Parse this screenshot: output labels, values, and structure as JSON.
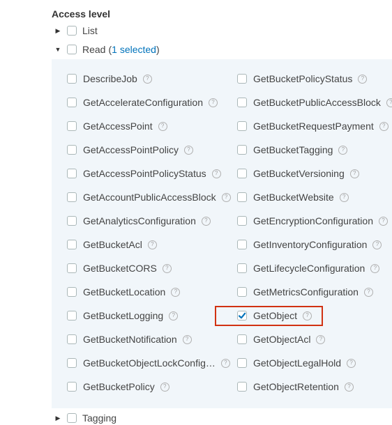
{
  "access_level": {
    "heading": "Access level",
    "groups": {
      "list": {
        "label": "List"
      },
      "read": {
        "label": "Read",
        "open_paren": "(",
        "selected_text": "1 selected",
        "close_paren": ")"
      },
      "tagging": {
        "label": "Tagging"
      }
    },
    "help_glyph": "?",
    "left_column": [
      {
        "label": "DescribeJob",
        "checked": false
      },
      {
        "label": "GetAccelerateConfiguration",
        "checked": false
      },
      {
        "label": "GetAccessPoint",
        "checked": false
      },
      {
        "label": "GetAccessPointPolicy",
        "checked": false
      },
      {
        "label": "GetAccessPointPolicyStatus",
        "checked": false
      },
      {
        "label": "GetAccountPublicAccessBlock",
        "checked": false
      },
      {
        "label": "GetAnalyticsConfiguration",
        "checked": false
      },
      {
        "label": "GetBucketAcl",
        "checked": false
      },
      {
        "label": "GetBucketCORS",
        "checked": false
      },
      {
        "label": "GetBucketLocation",
        "checked": false
      },
      {
        "label": "GetBucketLogging",
        "checked": false
      },
      {
        "label": "GetBucketNotification",
        "checked": false
      },
      {
        "label": "GetBucketObjectLockConfig…",
        "checked": false
      },
      {
        "label": "GetBucketPolicy",
        "checked": false
      }
    ],
    "right_column": [
      {
        "label": "GetBucketPolicyStatus",
        "checked": false
      },
      {
        "label": "GetBucketPublicAccessBlock",
        "checked": false
      },
      {
        "label": "GetBucketRequestPayment",
        "checked": false
      },
      {
        "label": "GetBucketTagging",
        "checked": false
      },
      {
        "label": "GetBucketVersioning",
        "checked": false
      },
      {
        "label": "GetBucketWebsite",
        "checked": false
      },
      {
        "label": "GetEncryptionConfiguration",
        "checked": false
      },
      {
        "label": "GetInventoryConfiguration",
        "checked": false
      },
      {
        "label": "GetLifecycleConfiguration",
        "checked": false
      },
      {
        "label": "GetMetricsConfiguration",
        "checked": false
      },
      {
        "label": "GetObject",
        "checked": true
      },
      {
        "label": "GetObjectAcl",
        "checked": false
      },
      {
        "label": "GetObjectLegalHold",
        "checked": false
      },
      {
        "label": "GetObjectRetention",
        "checked": false
      }
    ],
    "colors": {
      "highlight": "#d13212",
      "checkbox_check": "#0073bb",
      "panel_bg": "#f1f6fa",
      "link": "#0073bb"
    }
  }
}
